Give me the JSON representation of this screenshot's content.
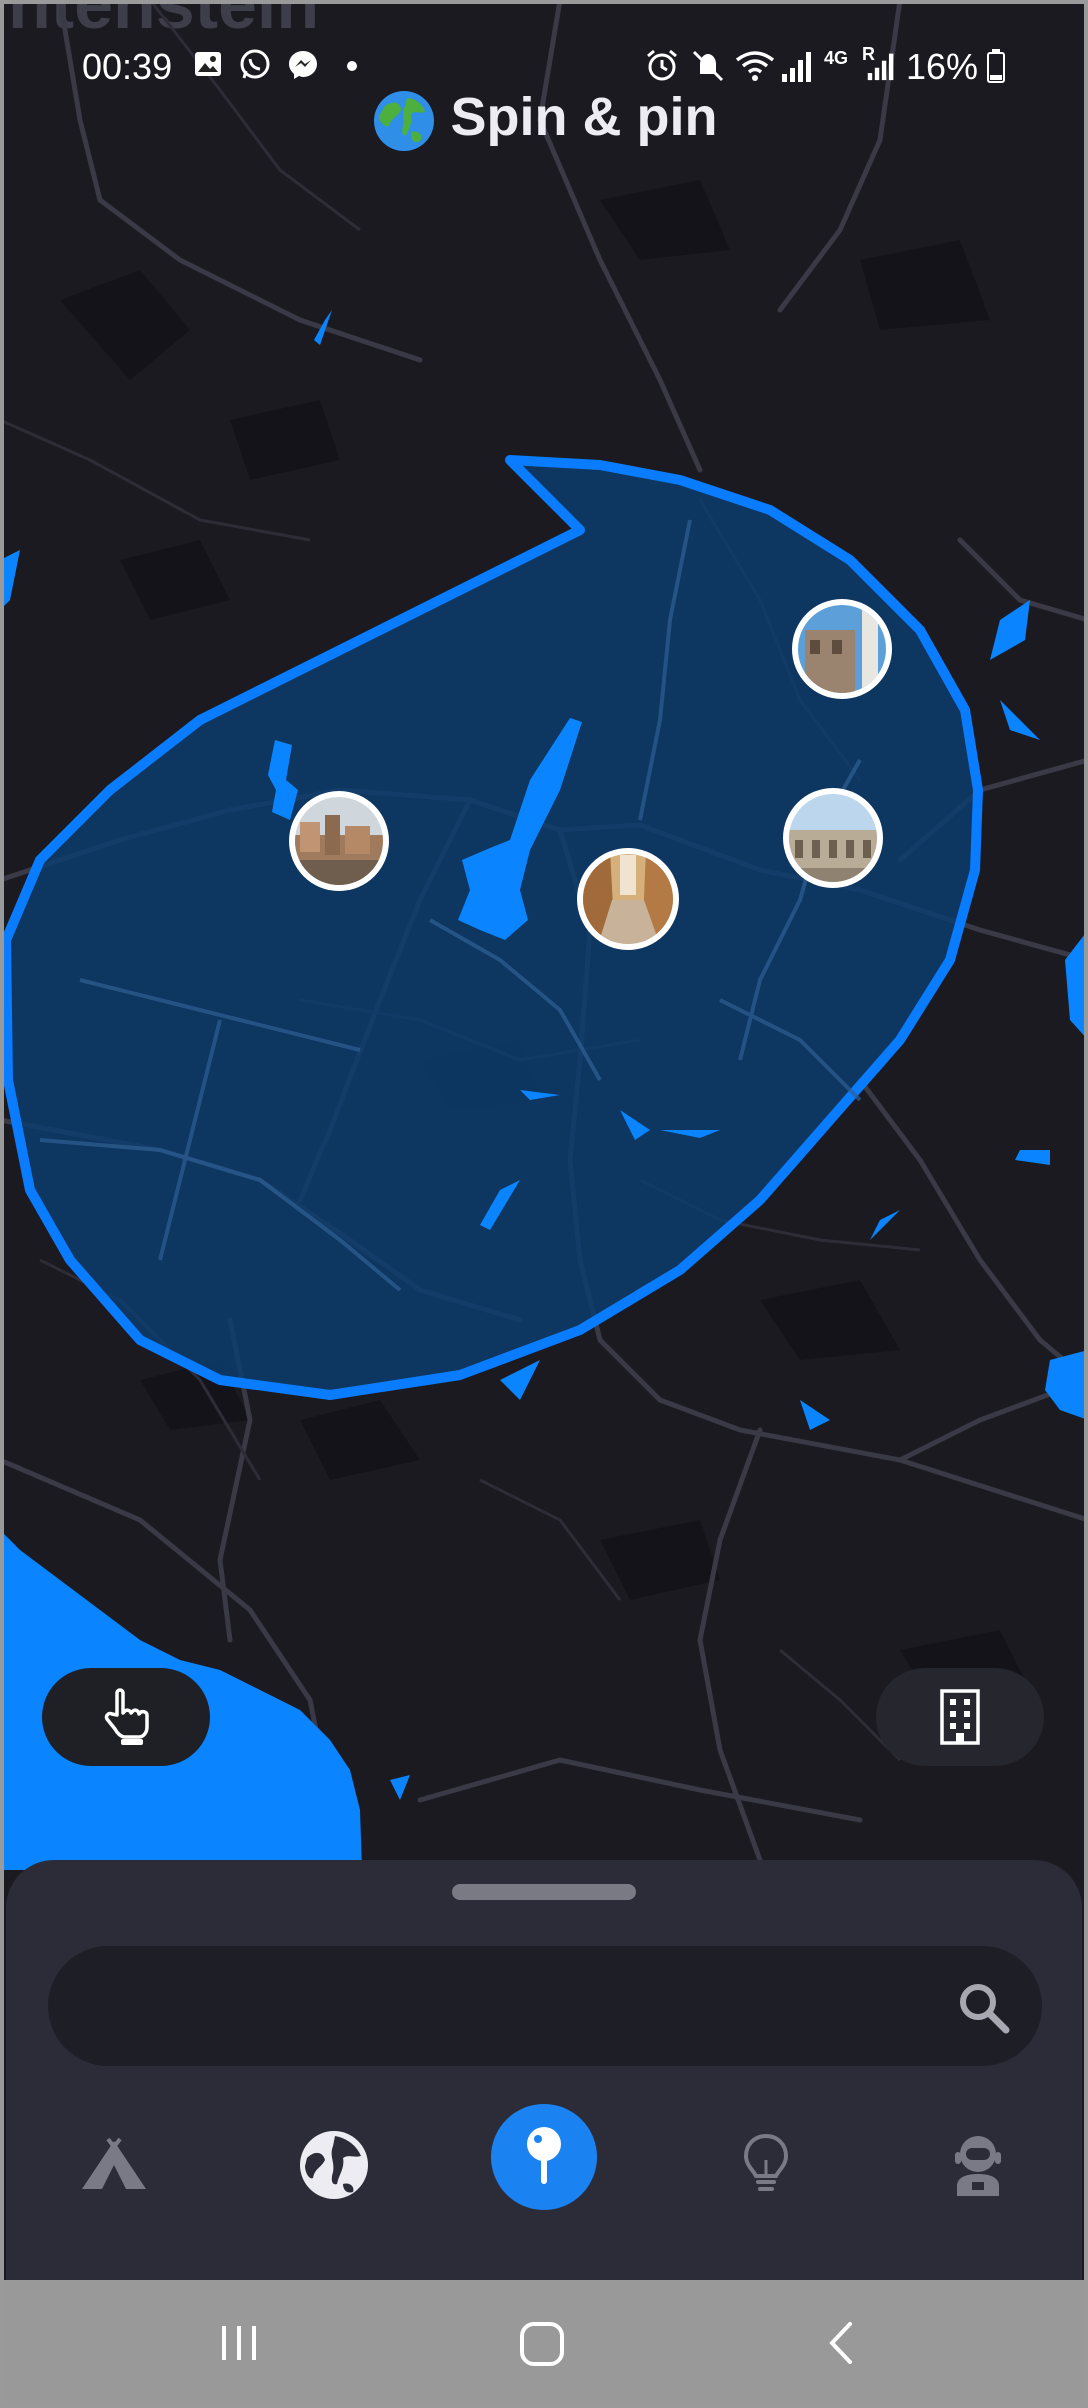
{
  "status_bar": {
    "time": "00:39",
    "battery": "16%",
    "network_labels": [
      "4G",
      "R"
    ],
    "icons": [
      "gallery-icon",
      "whatsapp-icon",
      "messenger-icon",
      "dot-icon",
      "alarm-icon",
      "mute-icon",
      "wifi-icon",
      "signal-icon",
      "battery-icon"
    ]
  },
  "header": {
    "title": "Spin & pin",
    "emoji_icon": "globe-icon"
  },
  "map": {
    "partial_place_label": "ntenstein",
    "colors": {
      "land": "#1b1a20",
      "water": "#0a85ff",
      "roads": "#3c3c48",
      "selection_fill": "#0b3d70",
      "selection_stroke": "#0a7cff"
    },
    "photo_markers": [
      "photo-marker-city",
      "photo-marker-street",
      "photo-marker-tower",
      "photo-marker-arena"
    ]
  },
  "floating_buttons": {
    "left_icon": "hand-pointer-icon",
    "right_icon": "building-icon"
  },
  "search": {
    "placeholder": "",
    "value": ""
  },
  "bottom_nav": {
    "items": [
      "camp-icon",
      "globe-explore-icon",
      "map-pin-icon",
      "lightbulb-icon",
      "astronaut-icon"
    ],
    "active": "map-pin-icon",
    "accent": "#1b82f2"
  },
  "android_nav": [
    "recent-apps-icon",
    "home-icon",
    "back-icon"
  ]
}
